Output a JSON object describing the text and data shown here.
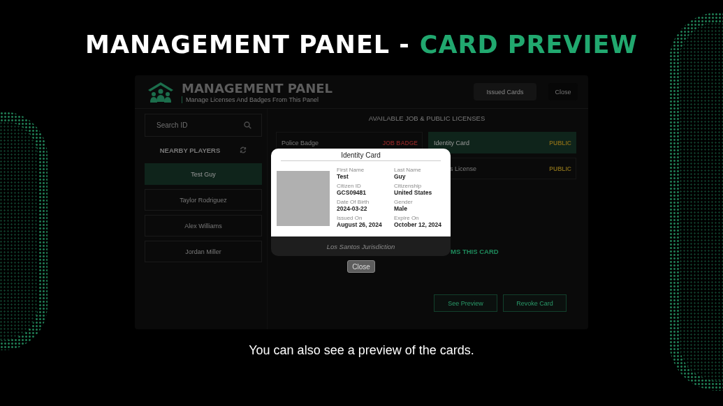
{
  "slide_title": {
    "text": "MANAGEMENT PANEL -",
    "highlight": "CARD PREVIEW"
  },
  "panel": {
    "title": "MANAGEMENT PANEL",
    "subtitle": "Manage Licenses And Badges From This Panel",
    "header_buttons": [
      {
        "label": "Issued Cards",
        "kind": "secondary"
      },
      {
        "label": "Close",
        "kind": "close"
      }
    ],
    "search": {
      "placeholder": "Search ID"
    },
    "players_heading": "NEARBY PLAYERS",
    "players": [
      {
        "name": "Test Guy",
        "selected": true
      },
      {
        "name": "Taylor Rodriguez",
        "selected": false
      },
      {
        "name": "Alex Williams",
        "selected": false
      },
      {
        "name": "Jordan Miller",
        "selected": false
      }
    ],
    "licenses_heading": "AVAILABLE JOB & PUBLIC LICENSES",
    "licenses": [
      {
        "name": "Police Badge",
        "tag": "JOB BADGE",
        "kind": "job",
        "selected": false
      },
      {
        "name": "Identity Card",
        "tag": "PUBLIC",
        "kind": "public",
        "selected": true
      },
      {
        "name": "s License",
        "tag": "PUBLIC",
        "kind": "public",
        "selected": false
      }
    ],
    "claim_text": "MS THIS CARD",
    "actions": [
      "See Preview",
      "Revoke Card"
    ]
  },
  "modal": {
    "title": "Identity Card",
    "fields": [
      {
        "label": "First Name",
        "value": "Test"
      },
      {
        "label": "Last Name",
        "value": "Guy"
      },
      {
        "label": "Citizen ID",
        "value": "GCS09481"
      },
      {
        "label": "Citizenship",
        "value": "United States"
      },
      {
        "label": "Date Of Birth",
        "value": "2024-03-22"
      },
      {
        "label": "Gender",
        "value": "Male"
      },
      {
        "label": "Issued On",
        "value": "August 26, 2024"
      },
      {
        "label": "Expire On",
        "value": "October 12, 2024"
      }
    ],
    "footer": "Los Santos Jurisdiction",
    "close_button": "Close"
  },
  "caption": "You can also see a preview of the cards."
}
